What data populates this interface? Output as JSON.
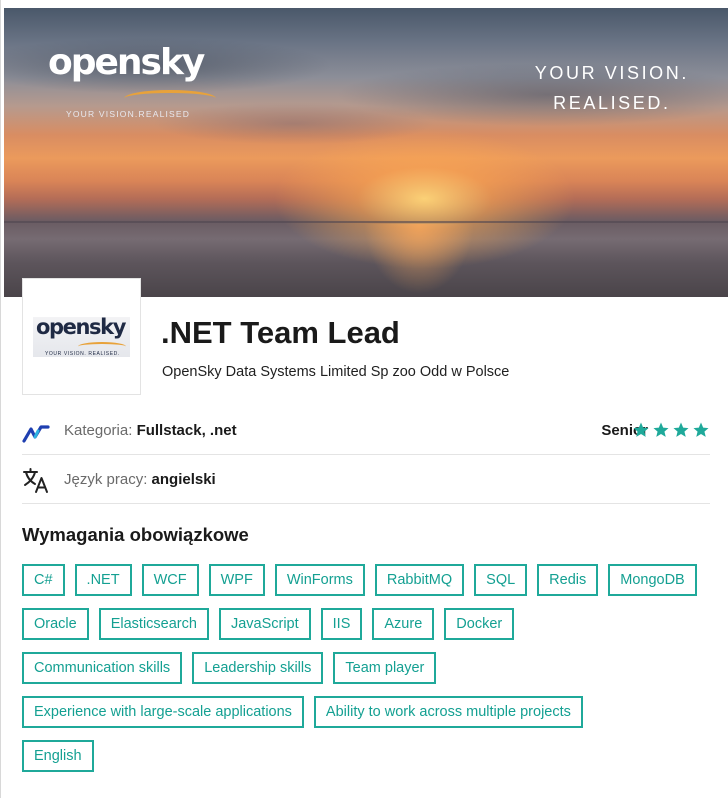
{
  "banner": {
    "logo_text": "opensky",
    "logo_tagline": "YOUR VISION.REALISED",
    "tagline_line1": "YOUR VISION.",
    "tagline_line2": "REALISED."
  },
  "company_logo": {
    "text": "opensky",
    "tagline": "YOUR VISION. REALISED."
  },
  "job": {
    "title": ".NET Team Lead",
    "company": "OpenSky Data Systems Limited Sp zoo Odd w Polsce"
  },
  "category": {
    "icon": "dotnet-icon",
    "label": "Kategoria:",
    "value": "Fullstack, .net"
  },
  "seniority": {
    "label": "Senior",
    "rating": 4,
    "max": 4,
    "color": "#1fa99a"
  },
  "language": {
    "icon": "translate-icon",
    "label": "Język pracy:",
    "value": "angielski"
  },
  "requirements": {
    "title": "Wymagania obowiązkowe",
    "accent_color": "#1fa99a",
    "rows": [
      [
        "C#",
        ".NET",
        "WCF",
        "WPF",
        "WinForms",
        "RabbitMQ",
        "SQL",
        "Redis",
        "MongoDB"
      ],
      [
        "Oracle",
        "Elasticsearch",
        "JavaScript",
        "IIS",
        "Azure",
        "Docker"
      ],
      [
        "Communication skills",
        "Leadership skills",
        "Team player"
      ],
      [
        "Experience with large-scale applications",
        "Ability to work across multiple projects"
      ],
      [
        "English"
      ]
    ]
  }
}
